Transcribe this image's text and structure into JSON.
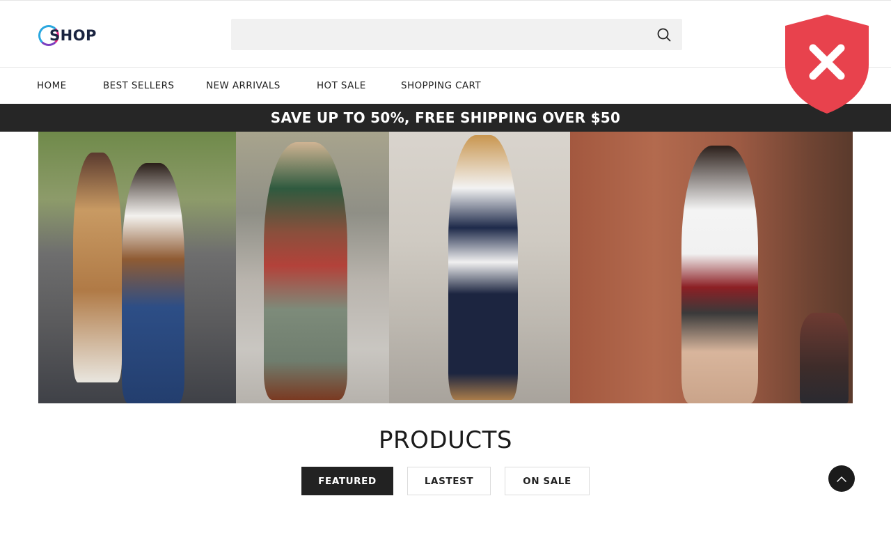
{
  "header": {
    "logo_text": "SHOP",
    "search": {
      "value": "",
      "placeholder": "",
      "icon": "search-icon"
    }
  },
  "nav": {
    "items": [
      {
        "label": "HOME"
      },
      {
        "label": "BEST SELLERS"
      },
      {
        "label": "NEW ARRIVALS"
      },
      {
        "label": "HOT SALE"
      },
      {
        "label": "SHOPPING CART"
      }
    ]
  },
  "promo": {
    "text": "SAVE UP TO 50%, FREE SHIPPING OVER $50"
  },
  "hero": {
    "images": [
      {
        "name": "hero-photo-street-duo"
      },
      {
        "name": "hero-photo-plaid-poncho"
      },
      {
        "name": "hero-photo-striped-tee"
      },
      {
        "name": "hero-photo-brick-wall"
      }
    ]
  },
  "products": {
    "title": "PRODUCTS",
    "tabs": [
      {
        "label": "FEATURED",
        "active": true
      },
      {
        "label": "LASTEST",
        "active": false
      },
      {
        "label": "ON SALE",
        "active": false
      }
    ]
  },
  "overlay": {
    "shield_icon": "shield-x-icon",
    "shield_color": "#e8424d"
  },
  "colors": {
    "promo_bg": "#262626",
    "active_tab_bg": "#222222",
    "scroll_top_bg": "#1b1b1b"
  }
}
